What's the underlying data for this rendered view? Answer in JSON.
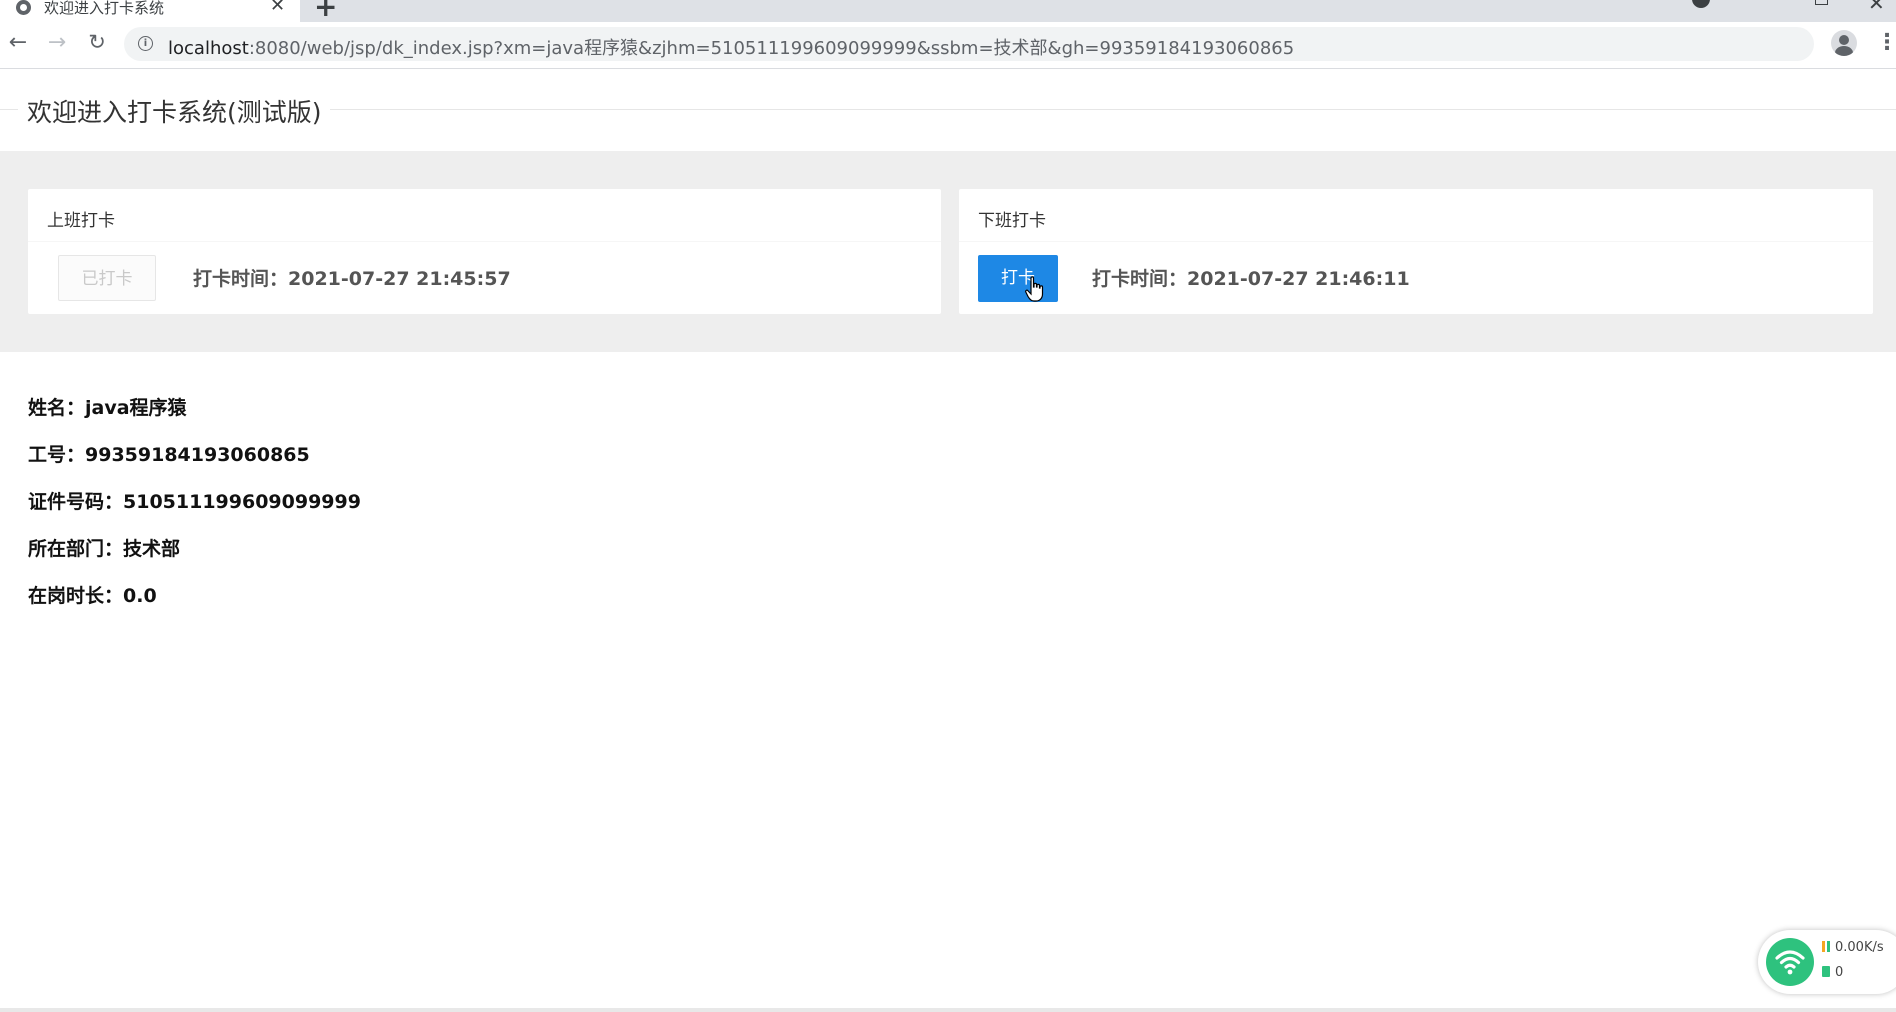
{
  "browser": {
    "tab_title": "欢迎进入打卡系统",
    "tab_close": "✕",
    "url_host": "localhost",
    "url_rest": ":8080/web/jsp/dk_index.jsp?xm=java程序猿&zjhm=510511199609099999&ssbm=技术部&gh=99359184193060865"
  },
  "page": {
    "title": "欢迎进入打卡系统(测试版)"
  },
  "clock_in": {
    "title": "上班打卡",
    "button_label": "已打卡",
    "time_text": "打卡时间：2021-07-27 21:45:57"
  },
  "clock_out": {
    "title": "下班打卡",
    "button_label": "打卡",
    "time_text": "打卡时间：2021-07-27 21:46:11"
  },
  "employee": {
    "name": "姓名：java程序猿",
    "job_number": "工号：99359184193060865",
    "id_number": "证件号码：510511199609099999",
    "department": "所在部门：技术部",
    "duty_hours": "在岗时长：0.0"
  },
  "network_widget": {
    "speed": "0.00K/s",
    "count": "0"
  },
  "colors": {
    "primary_button": "#1e88e5",
    "band_background": "#eeeeee",
    "wifi_green": "#2ec27e"
  }
}
